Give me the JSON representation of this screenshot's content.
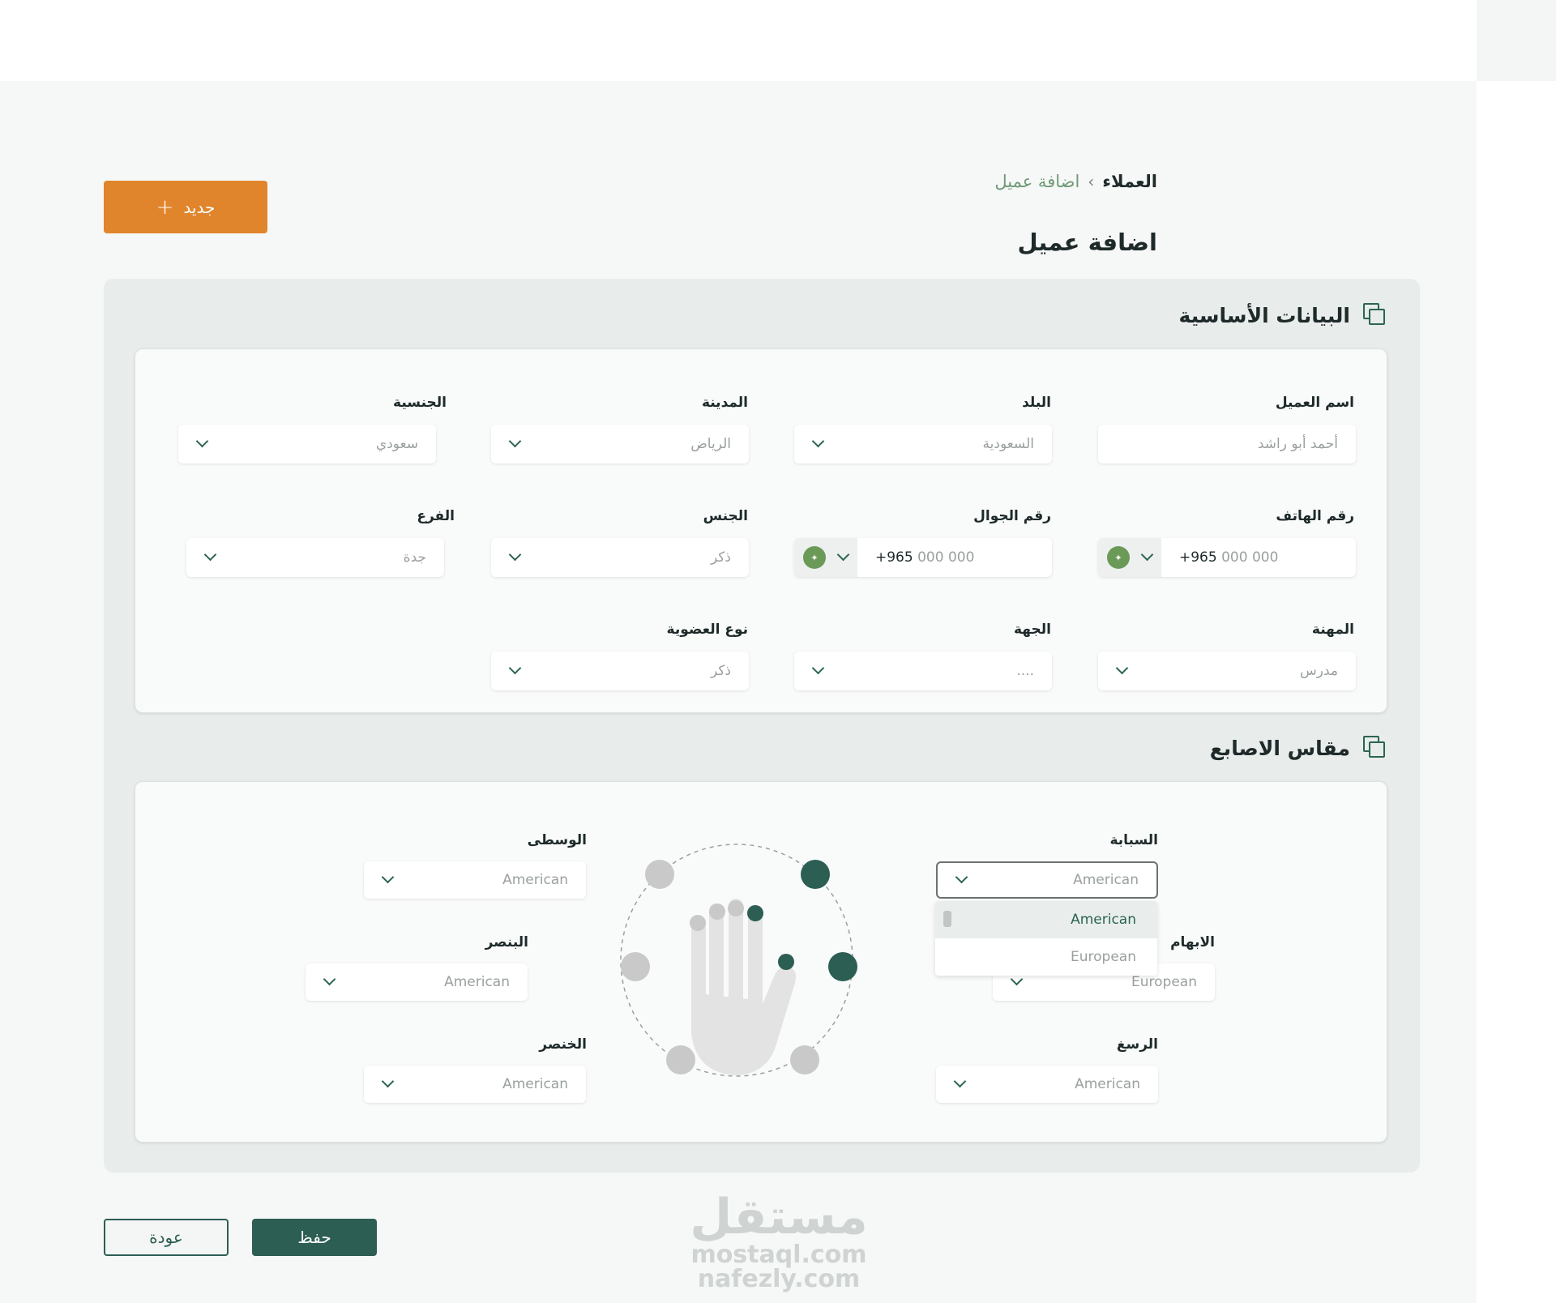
{
  "breadcrumb": {
    "root": "العملاء",
    "current": "اضافة عميل"
  },
  "page_title": "اضافة عميل",
  "new_button": {
    "label": "جديد"
  },
  "basic_section": {
    "title": "البيانات الأساسية",
    "fields": {
      "client_name": {
        "label": "اسم العميل",
        "placeholder": "أحمد أبو راشد"
      },
      "country": {
        "label": "البلد",
        "value": "السعودية"
      },
      "city": {
        "label": "المدينة",
        "value": "الرياض"
      },
      "nationality": {
        "label": "الجنسية",
        "value": "سعودي"
      },
      "phone": {
        "label": "رقم الهاتف",
        "code": "+965",
        "placeholder": "000 000"
      },
      "mobile": {
        "label": "رقم الجوال",
        "code": "+965",
        "placeholder": "000 000"
      },
      "gender": {
        "label": "الجنس",
        "value": "ذكر"
      },
      "branch": {
        "label": "الفرع",
        "value": "جدة"
      },
      "profession": {
        "label": "المهنة",
        "value": "مدرس"
      },
      "party": {
        "label": "الجهة",
        "value": "...."
      },
      "membership": {
        "label": "نوع العضوية",
        "value": "ذكر"
      }
    }
  },
  "finger_section": {
    "title": "مقاس الاصابع",
    "fields": {
      "index": {
        "label": "السبابة",
        "value": "American"
      },
      "thumb": {
        "label": "الابهام",
        "value": "European"
      },
      "wrist": {
        "label": "الرسغ",
        "value": "American"
      },
      "middle": {
        "label": "الوسطى",
        "value": "American"
      },
      "ring": {
        "label": "البنصر",
        "value": "American"
      },
      "pinky": {
        "label": "الخنصر",
        "value": "American"
      }
    },
    "dropdown_options": [
      "American",
      "European"
    ]
  },
  "actions": {
    "save": "حفظ",
    "back": "عودة"
  },
  "watermark": {
    "line1": "مستقل",
    "line2": "mostaql.com",
    "line3": "nafezly.com"
  },
  "colors": {
    "primary": "#2c5e53",
    "accent": "#e0852c",
    "breadcrumb_current": "#6f9a76",
    "active_dot": "#2c5e53",
    "inactive_dot": "#c9c9c9"
  }
}
